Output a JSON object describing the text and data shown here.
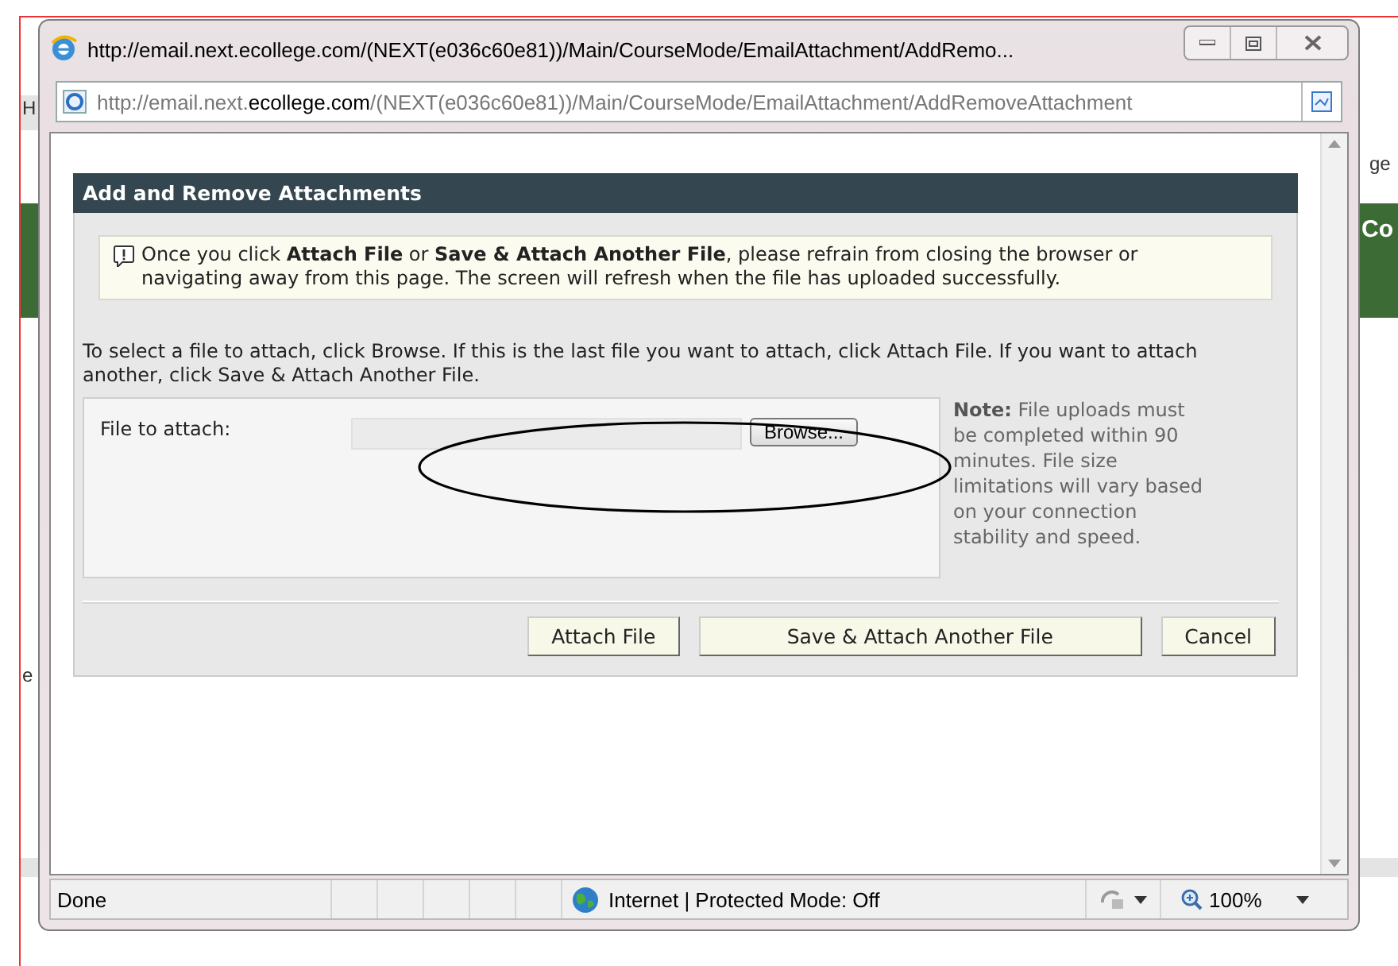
{
  "background": {
    "fragments": [
      "H",
      "ge",
      "Co",
      "e"
    ]
  },
  "window": {
    "title": "http://email.next.ecollege.com/(NEXT(e036c60e81))/Main/CourseMode/EmailAttachment/AddRemo...",
    "address": {
      "prefix": "http://email.next.",
      "domain": "ecollege.com",
      "path": "/(NEXT(e036c60e81))/Main/CourseMode/EmailAttachment/AddRemoveAttachment"
    }
  },
  "dialog": {
    "title": "Add and Remove Attachments",
    "warning": "Once you click **Attach File** or **Save & Attach Another File**, please refrain from closing the browser or navigating away from this page. The screen will refresh when the file has uploaded successfully.",
    "instructions": "To select a file to attach, click Browse. If this is the last file you want to attach, click Attach File. If you want to attach another, click Save & Attach Another File.",
    "field": {
      "label": "File to attach:",
      "button": "Browse..."
    },
    "note": "**Note:** File uploads must be completed within 90 minutes. File size limitations will vary based on your connection stability and speed.",
    "buttons": [
      "Attach File",
      "Save & Attach Another File",
      "Cancel"
    ]
  },
  "status_bar": {
    "text": "Done",
    "zone": "Internet | Protected Mode: Off",
    "zoom": "100%"
  }
}
